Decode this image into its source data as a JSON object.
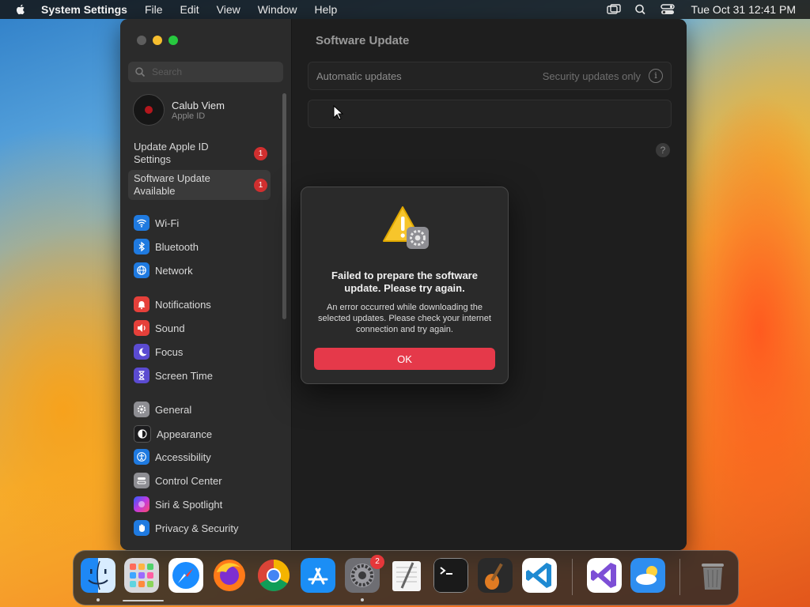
{
  "menubar": {
    "apple_icon": "apple-logo-icon",
    "app_name": "System Settings",
    "menus": [
      "File",
      "Edit",
      "View",
      "Window",
      "Help"
    ],
    "status_icons": [
      "screen-mirroring-icon",
      "spotlight-search-icon",
      "control-center-icon"
    ],
    "clock": "Tue Oct 31  12:41 PM"
  },
  "window": {
    "traffic_lights": [
      "close",
      "minimize",
      "zoom"
    ],
    "sidebar": {
      "search_placeholder": "Search",
      "profile": {
        "name": "Calub Viem",
        "subtitle": "Apple ID"
      },
      "alerts": [
        {
          "label": "Update Apple ID Settings",
          "badge": "1"
        },
        {
          "label": "Software Update Available",
          "badge": "1"
        }
      ],
      "groups": [
        [
          {
            "label": "Wi-Fi",
            "icon": "wifi-icon",
            "color": "#1f7ae0"
          },
          {
            "label": "Bluetooth",
            "icon": "bluetooth-icon",
            "color": "#1f7ae0"
          },
          {
            "label": "Network",
            "icon": "globe-icon",
            "color": "#1f7ae0"
          }
        ],
        [
          {
            "label": "Notifications",
            "icon": "bell-icon",
            "color": "#e5403a"
          },
          {
            "label": "Sound",
            "icon": "speaker-icon",
            "color": "#e5403a"
          },
          {
            "label": "Focus",
            "icon": "moon-icon",
            "color": "#5b4bd1"
          },
          {
            "label": "Screen Time",
            "icon": "hourglass-icon",
            "color": "#5b4bd1"
          }
        ],
        [
          {
            "label": "General",
            "icon": "gear-icon",
            "color": "#8e8e93"
          },
          {
            "label": "Appearance",
            "icon": "appearance-icon",
            "color": "#1c1c1e"
          },
          {
            "label": "Accessibility",
            "icon": "accessibility-icon",
            "color": "#1f7ae0"
          },
          {
            "label": "Control Center",
            "icon": "control-center-icon",
            "color": "#8e8e93"
          },
          {
            "label": "Siri & Spotlight",
            "icon": "siri-icon",
            "color": "#c03ae0"
          },
          {
            "label": "Privacy & Security",
            "icon": "hand-icon",
            "color": "#1f7ae0"
          }
        ]
      ]
    },
    "main": {
      "title": "Software Update",
      "automatic_updates": {
        "label": "Automatic updates",
        "value": "Security updates only"
      },
      "help_icon": "question-icon"
    }
  },
  "dialog": {
    "icon": "warning-triangle-with-gear-icon",
    "title": "Failed to prepare the software update. Please try again.",
    "message": "An error occurred while downloading the selected updates. Please check your internet connection and try again.",
    "ok_label": "OK"
  },
  "dock": {
    "apps": [
      {
        "name": "Finder",
        "icon": "finder-icon",
        "running": true
      },
      {
        "name": "Launchpad",
        "icon": "launchpad-icon",
        "running": false
      },
      {
        "name": "Safari",
        "icon": "safari-icon",
        "running": false
      },
      {
        "name": "Firefox",
        "icon": "firefox-icon",
        "running": false
      },
      {
        "name": "Google Chrome",
        "icon": "chrome-icon",
        "running": false
      },
      {
        "name": "App Store",
        "icon": "app-store-icon",
        "running": false
      },
      {
        "name": "System Settings",
        "icon": "system-settings-icon",
        "running": true,
        "badge": "2"
      },
      {
        "name": "TextEdit",
        "icon": "textedit-icon",
        "running": false
      },
      {
        "name": "Terminal",
        "icon": "terminal-icon",
        "running": false
      },
      {
        "name": "GarageBand",
        "icon": "garageband-icon",
        "running": false
      },
      {
        "name": "Visual Studio Code",
        "icon": "vscode-icon",
        "running": false
      },
      {
        "name": "Visual Studio",
        "icon": "visual-studio-icon",
        "running": false
      },
      {
        "name": "Weather",
        "icon": "weather-icon",
        "running": false
      },
      {
        "name": "Trash",
        "icon": "trash-icon",
        "running": false
      }
    ]
  }
}
